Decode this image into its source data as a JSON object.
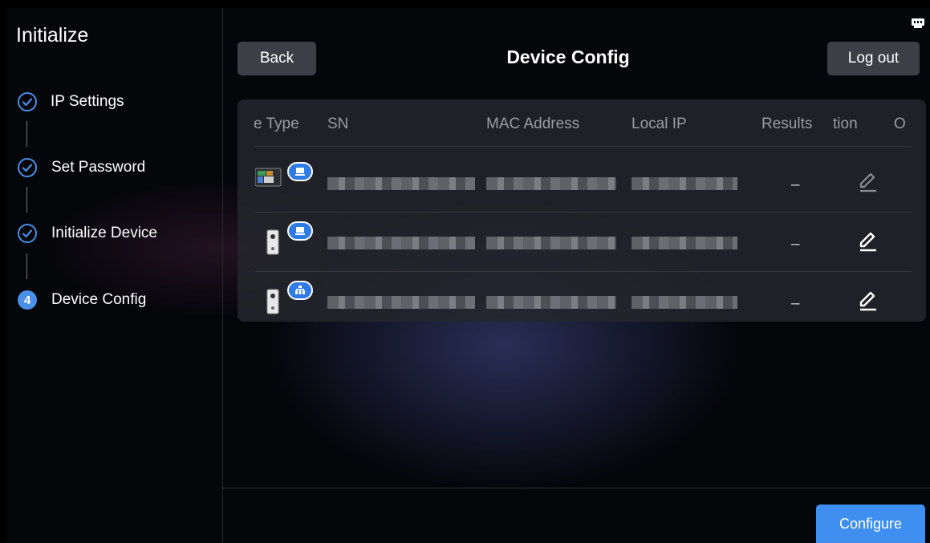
{
  "sidebar": {
    "title": "Initialize",
    "steps": [
      {
        "label": "IP Settings",
        "state": "done"
      },
      {
        "label": "Set Password",
        "state": "done"
      },
      {
        "label": "Initialize Device",
        "state": "done"
      },
      {
        "label": "Device Config",
        "state": "active",
        "number": "4"
      }
    ]
  },
  "header": {
    "back_label": "Back",
    "title": "Device Config",
    "logout_label": "Log out"
  },
  "table": {
    "columns": [
      "e Type",
      "SN",
      "MAC Address",
      "Local IP",
      "Results",
      "tion",
      "O"
    ],
    "rows": [
      {
        "device": "indoor-monitor",
        "badge": "monitor-badge-icon",
        "result": "–",
        "edit_enabled": false
      },
      {
        "device": "door-station",
        "badge": "monitor-badge-icon",
        "result": "–",
        "edit_enabled": true
      },
      {
        "device": "door-station",
        "badge": "network-badge-icon",
        "result": "–",
        "edit_enabled": true
      }
    ]
  },
  "footer": {
    "configure_label": "Configure"
  },
  "colors": {
    "accent": "#4a8fe8",
    "button_primary": "#3f8ff0",
    "button_secondary": "#3c3f45",
    "panel": "#24262c"
  }
}
